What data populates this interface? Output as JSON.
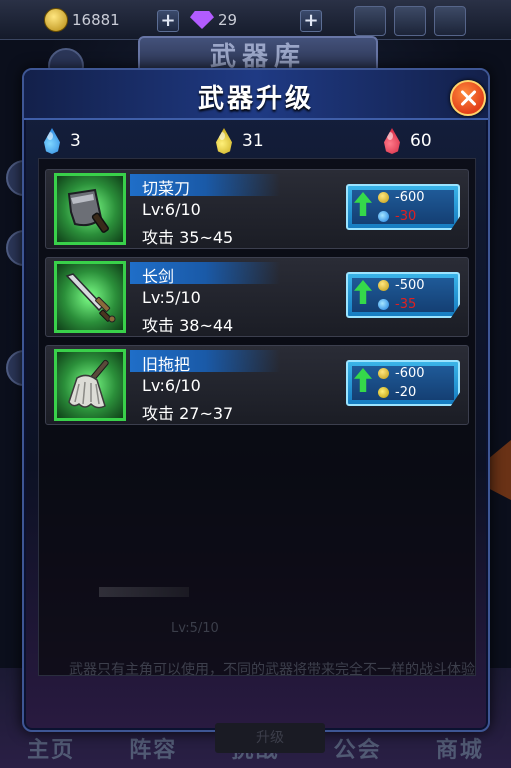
{
  "background": {
    "gold": "16881",
    "gems": "29",
    "screen_title": "武器库",
    "ghost_level": "Lv:5/10",
    "ghost_desc": "武器只有主角可以使用，不同的武器将带来完全不一样的战斗体验",
    "ghost_button": "升级",
    "bottom_tabs": [
      "主页",
      "阵容",
      "挑战",
      "公会",
      "商城"
    ]
  },
  "dialog": {
    "title": "武器升级",
    "resources": [
      {
        "icon": "blue-drop-icon",
        "value": "3"
      },
      {
        "icon": "yellow-drop-icon",
        "value": "31"
      },
      {
        "icon": "red-drop-icon",
        "value": "60"
      }
    ]
  },
  "weapons": [
    {
      "name": "切菜刀",
      "level": "Lv:6/10",
      "attack": "攻击 35~45",
      "icon": "cleaver-icon",
      "cost_gold": "-600",
      "cost_drop": "-30",
      "cost_drop_icon": "blue-drop-icon",
      "cost_drop_insufficient": true
    },
    {
      "name": "长剑",
      "level": "Lv:5/10",
      "attack": "攻击 38~44",
      "icon": "sword-icon",
      "cost_gold": "-500",
      "cost_drop": "-35",
      "cost_drop_icon": "blue-drop-icon",
      "cost_drop_insufficient": true
    },
    {
      "name": "旧拖把",
      "level": "Lv:6/10",
      "attack": "攻击 27~37",
      "icon": "mop-icon",
      "cost_gold": "-600",
      "cost_drop": "-20",
      "cost_drop_icon": "yellow-drop-icon",
      "cost_drop_insufficient": false
    }
  ],
  "colors": {
    "accent_green": "#39d14a",
    "insufficient_red": "#e02020",
    "close_orange": "#e2401a"
  }
}
